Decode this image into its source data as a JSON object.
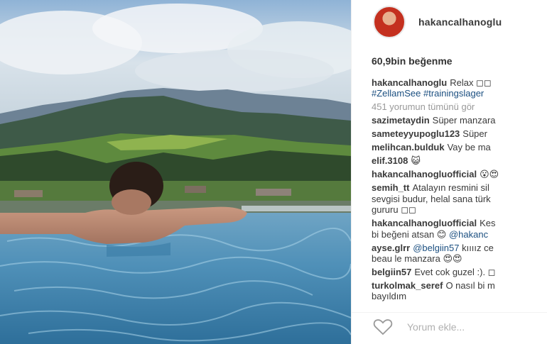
{
  "post": {
    "username": "hakancalhanoglu",
    "likes": "60,9bin beğenme",
    "caption": {
      "user": "hakancalhanoglu",
      "text": "Relax ◻◻",
      "hashtags": "#ZellamSee #trainingslager"
    },
    "view_all": "451 yorumun tümünü gör",
    "comments": [
      {
        "user": "sazimetaydin",
        "text": "Süper manzara"
      },
      {
        "user": "sameteyyupoglu123",
        "text": "Süper"
      },
      {
        "user": "melihcan.bulduk",
        "text": "Vay be ma"
      },
      {
        "user": "elif.3108",
        "text": "😺"
      },
      {
        "user": "hakancalhanogluofficial",
        "text": "😮😍"
      },
      {
        "user": "semih_tt",
        "text": "Atalayın resmini sil",
        "text2": "sevgisi budur, helal sana türk",
        "text3": "gururu ◻◻"
      },
      {
        "user": "hakancalhanogluofficial",
        "text": "Kes",
        "text2": "bi beğeni atsan 😊",
        "mention": "@hakanc"
      },
      {
        "user": "ayse.glrr",
        "mention": "@belgiin57",
        "text": "kıııız ce",
        "text2": "beau le manzara 😍😍"
      },
      {
        "user": "belgiin57",
        "text": "Evet cok guzel :). ◻"
      },
      {
        "user": "turkolmak_seref",
        "text": "O nasıl bi m",
        "text2": "bayıldım"
      }
    ],
    "add_comment_placeholder": "Yorum ekle...",
    "icons": {
      "like": "heart-icon"
    }
  }
}
